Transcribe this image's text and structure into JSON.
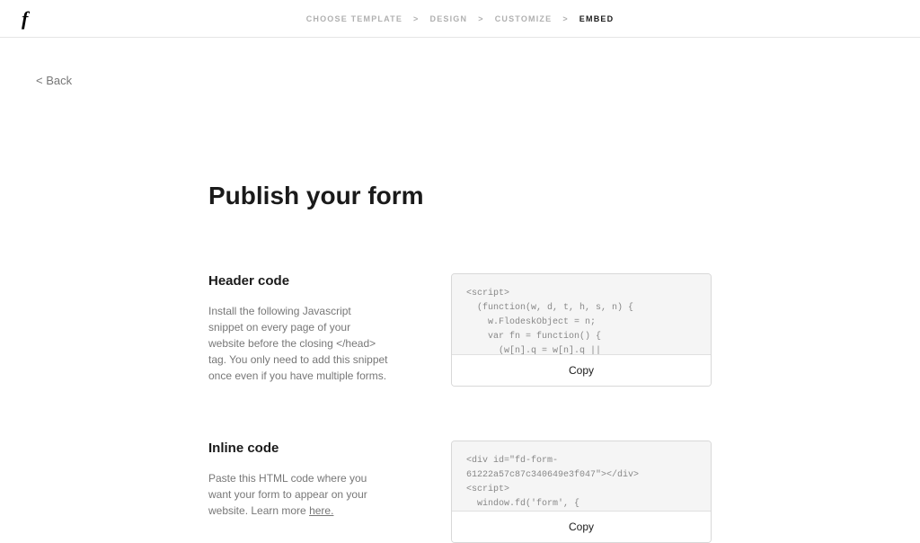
{
  "logo": "f",
  "breadcrumb": {
    "steps": [
      {
        "label": "CHOOSE TEMPLATE",
        "active": false
      },
      {
        "label": "DESIGN",
        "active": false
      },
      {
        "label": "CUSTOMIZE",
        "active": false
      },
      {
        "label": "EMBED",
        "active": true
      }
    ],
    "separator": ">"
  },
  "back": "< Back",
  "page_title": "Publish your form",
  "sections": {
    "header_code": {
      "title": "Header code",
      "desc": "Install the following Javascript snippet on every page of your website before the closing </head> tag. You only need to add this snippet once even if you have multiple forms.",
      "code": "<script>\n  (function(w, d, t, h, s, n) {\n    w.FlodeskObject = n;\n    var fn = function() {\n      (w[n].q = w[n].q ||",
      "copy_label": "Copy"
    },
    "inline_code": {
      "title": "Inline code",
      "desc_prefix": "Paste this HTML code where you want your form to appear on your website. Learn more ",
      "desc_link": "here.",
      "code": "<div id=\"fd-form-\n61222a57c87c340649e3f047\"></div>\n<script>\n  window.fd('form', {\n    formId:",
      "copy_label": "Copy"
    }
  }
}
